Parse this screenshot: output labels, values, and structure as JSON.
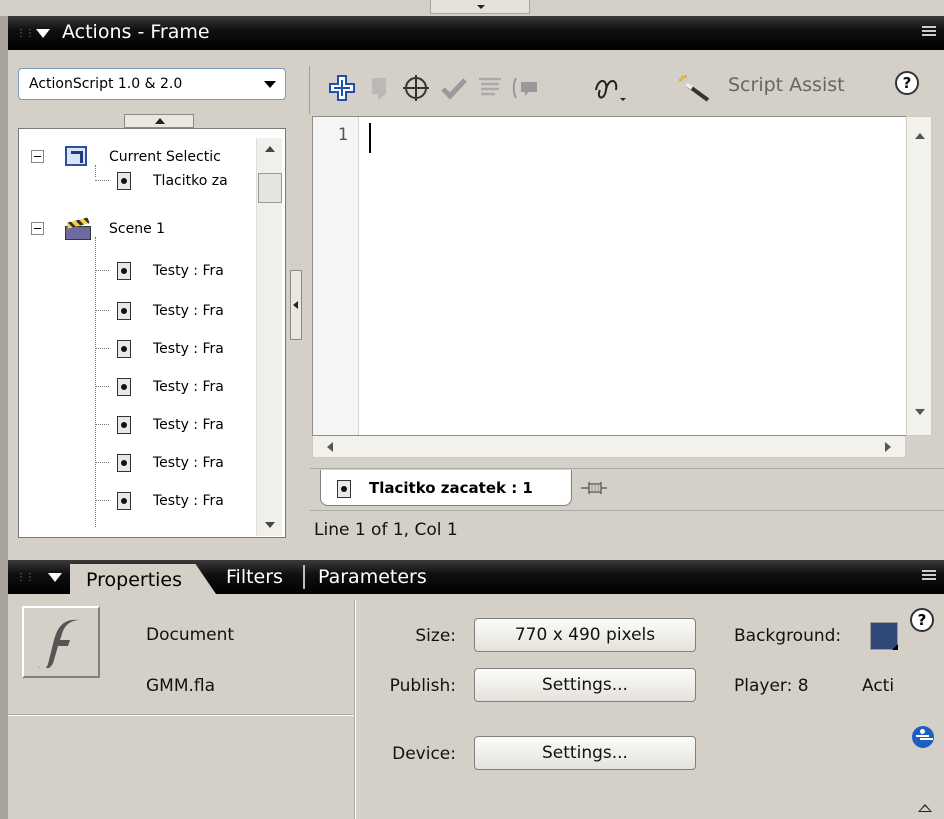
{
  "actions_panel": {
    "title": "Actions - Frame",
    "language_select": {
      "value": "ActionScript 1.0 & 2.0"
    },
    "tree": {
      "current_selection": "Current Selectic",
      "selection_child": "Tlacitko za",
      "scene": "Scene 1",
      "frames": [
        "Testy : Fra",
        "Testy : Fra",
        "Testy : Fra",
        "Testy : Fra",
        "Testy : Fra",
        "Testy : Fra",
        "Testy : Fra"
      ]
    },
    "toolbar": {
      "icons": [
        "add-script-item-icon",
        "find-icon",
        "insert-target-path-icon",
        "check-syntax-icon",
        "auto-format-icon",
        "code-hint-icon",
        "debug-options-icon"
      ],
      "script_assist": "Script Assist",
      "help": "?"
    },
    "editor": {
      "line_number": "1",
      "content": ""
    },
    "script_tab": {
      "label": "Tlacitko zacatek : 1"
    },
    "status": "Line 1 of 1, Col 1"
  },
  "properties_panel": {
    "tabs": {
      "properties": "Properties",
      "filters": "Filters",
      "parameters": "Parameters"
    },
    "document_label": "Document",
    "file_name": "GMM.fla",
    "size_label": "Size:",
    "size_value": "770 x 490 pixels",
    "publish_label": "Publish:",
    "publish_button": "Settings...",
    "device_label": "Device:",
    "device_button": "Settings...",
    "background_label": "Background:",
    "background_color": "#2f4878",
    "player_label": "Player: 8",
    "actionscript_label": "Acti",
    "help": "?"
  }
}
